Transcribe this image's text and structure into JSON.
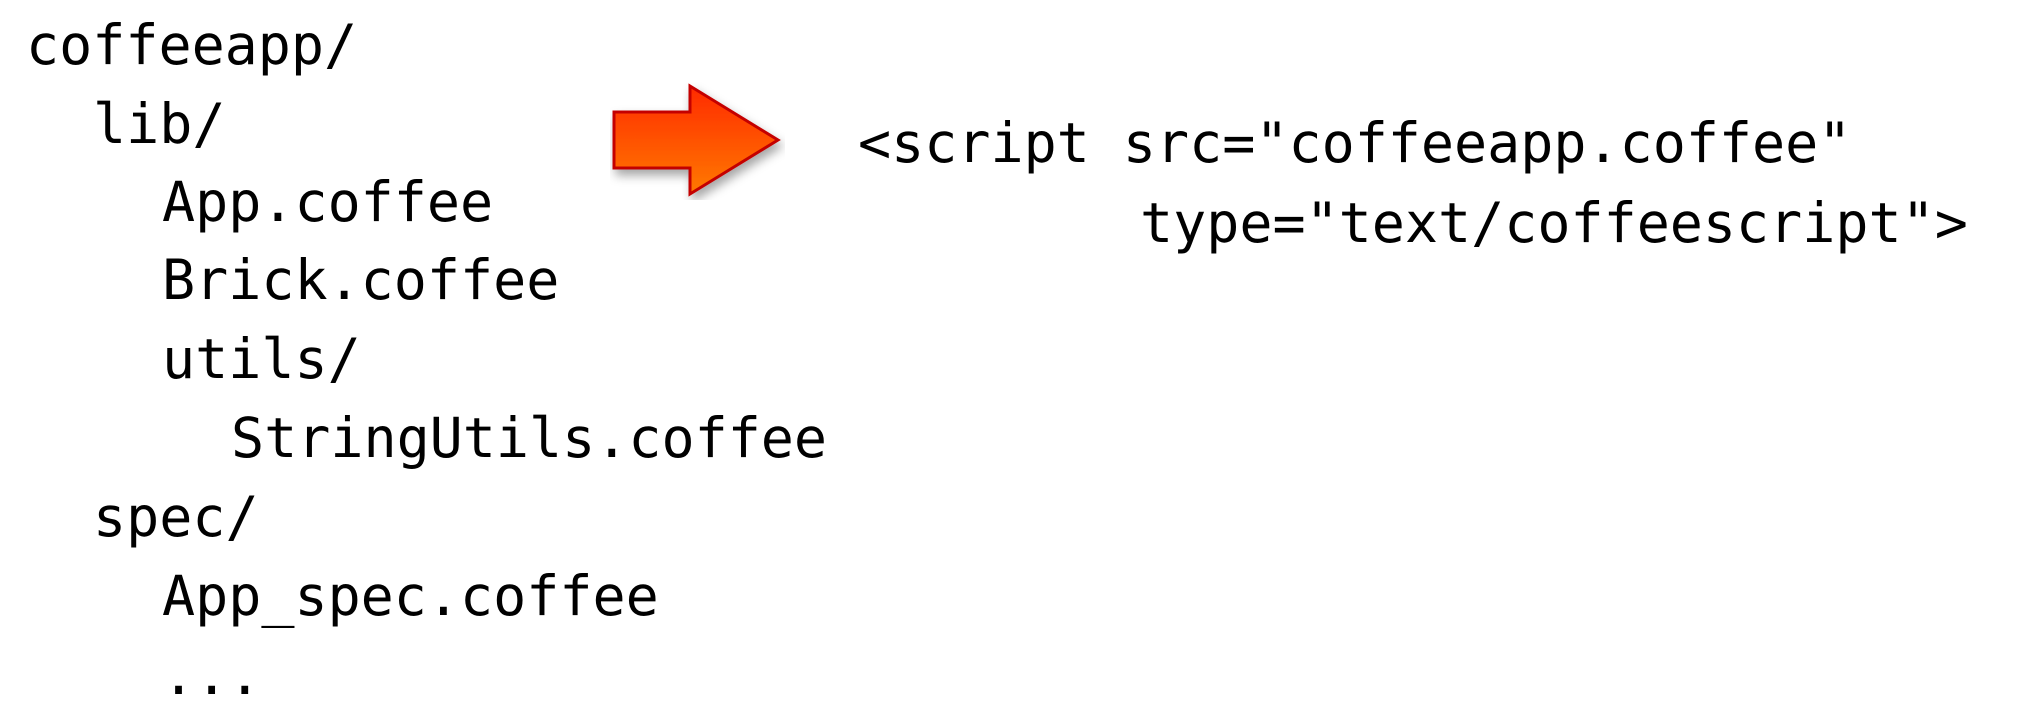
{
  "tree": [
    {
      "text": "coffeeapp/",
      "depth": 0
    },
    {
      "text": "lib/",
      "depth": 1
    },
    {
      "text": "App.coffee",
      "depth": 2
    },
    {
      "text": "Brick.coffee",
      "depth": 2
    },
    {
      "text": "utils/",
      "depth": 2
    },
    {
      "text": "StringUtils.coffee",
      "depth": 3
    },
    {
      "text": "spec/",
      "depth": 1
    },
    {
      "text": "App_spec.coffee",
      "depth": 2
    },
    {
      "text": "...",
      "depth": 2
    }
  ],
  "arrow": {
    "icon": "right-arrow-icon",
    "color_top": "#ff2a00",
    "color_bottom": "#ff7a00",
    "stroke": "#c40000"
  },
  "script_tag": {
    "line1": "<script src=\"coffeeapp.coffee\"",
    "line2": "type=\"text/coffeescript\">"
  }
}
